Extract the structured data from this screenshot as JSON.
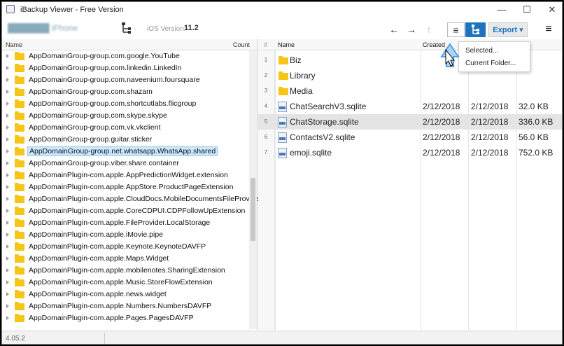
{
  "window": {
    "title": "iBackup Viewer - Free Version",
    "minimize_glyph": "—",
    "maximize_glyph": "☐",
    "close_glyph": "✕"
  },
  "toolbar": {
    "device_name": "███████ iPhone",
    "ios_label": "iOS Version:",
    "ios_version": "11.2",
    "back_glyph": "←",
    "forward_glyph": "→",
    "up_glyph": "↑",
    "list_view_glyph": "≡",
    "export_label": "Export ▾",
    "menu_glyph": "≡"
  },
  "left_pane": {
    "columns": {
      "name": "Name",
      "count": "Count"
    },
    "items": [
      "AppDomainGroup-group.com.google.YouTube",
      "AppDomainGroup-group.com.linkedin.LinkedIn",
      "AppDomainGroup-group.com.naveenium.foursquare",
      "AppDomainGroup-group.com.shazam",
      "AppDomainGroup-group.com.shortcutlabs.flicgroup",
      "AppDomainGroup-group.com.skype.skype",
      "AppDomainGroup-group.com.vk.vkclient",
      "AppDomainGroup-group.guitar.sticker",
      "AppDomainGroup-group.net.whatsapp.WhatsApp.shared",
      "AppDomainGroup-group.viber.share.container",
      "AppDomainPlugin-com.apple.AppPredictionWidget.extension",
      "AppDomainPlugin-com.apple.AppStore.ProductPageExtension",
      "AppDomainPlugin-com.apple.CloudDocs.MobileDocumentsFileProvider",
      "AppDomainPlugin-com.apple.CoreCDPUI.CDPFollowUpExtension",
      "AppDomainPlugin-com.apple.FileProvider.LocalStorage",
      "AppDomainPlugin-com.apple.iMovie.pipe",
      "AppDomainPlugin-com.apple.Keynote.KeynoteDAVFP",
      "AppDomainPlugin-com.apple.Maps.Widget",
      "AppDomainPlugin-com.apple.mobilenotes.SharingExtension",
      "AppDomainPlugin-com.apple.Music.StoreFlowExtension",
      "AppDomainPlugin-com.apple.news.widget",
      "AppDomainPlugin-com.apple.Numbers.NumbersDAVFP",
      "AppDomainPlugin-com.apple.Pages.PagesDAVFP"
    ],
    "selected_index": 8
  },
  "right_pane": {
    "columns": {
      "index": "#",
      "name": "Name",
      "created": "Created"
    },
    "rows": [
      {
        "idx": "1",
        "type": "folder",
        "name": "Biz",
        "created": "",
        "modified": "",
        "size": ""
      },
      {
        "idx": "2",
        "type": "folder",
        "name": "Library",
        "created": "",
        "modified": "",
        "size": ""
      },
      {
        "idx": "3",
        "type": "folder",
        "name": "Media",
        "created": "",
        "modified": "",
        "size": ""
      },
      {
        "idx": "4",
        "type": "file",
        "name": "ChatSearchV3.sqlite",
        "created": "2/12/2018",
        "modified": "2/12/2018",
        "size": "32.0 KB"
      },
      {
        "idx": "5",
        "type": "file",
        "name": "ChatStorage.sqlite",
        "created": "2/12/2018",
        "modified": "2/12/2018",
        "size": "336.0 KB"
      },
      {
        "idx": "6",
        "type": "file",
        "name": "ContactsV2.sqlite",
        "created": "2/12/2018",
        "modified": "2/12/2018",
        "size": "56.0 KB"
      },
      {
        "idx": "7",
        "type": "file",
        "name": "emoji.sqlite",
        "created": "2/12/2018",
        "modified": "2/12/2018",
        "size": "752.0 KB"
      }
    ],
    "selected_index": 4
  },
  "export_menu": {
    "items": [
      "Selected...",
      "Current Folder..."
    ]
  },
  "status": {
    "version": "4.05.2"
  },
  "colors": {
    "accent": "#1e73be",
    "folder": "#f5c518",
    "selection": "#cce8ff"
  }
}
